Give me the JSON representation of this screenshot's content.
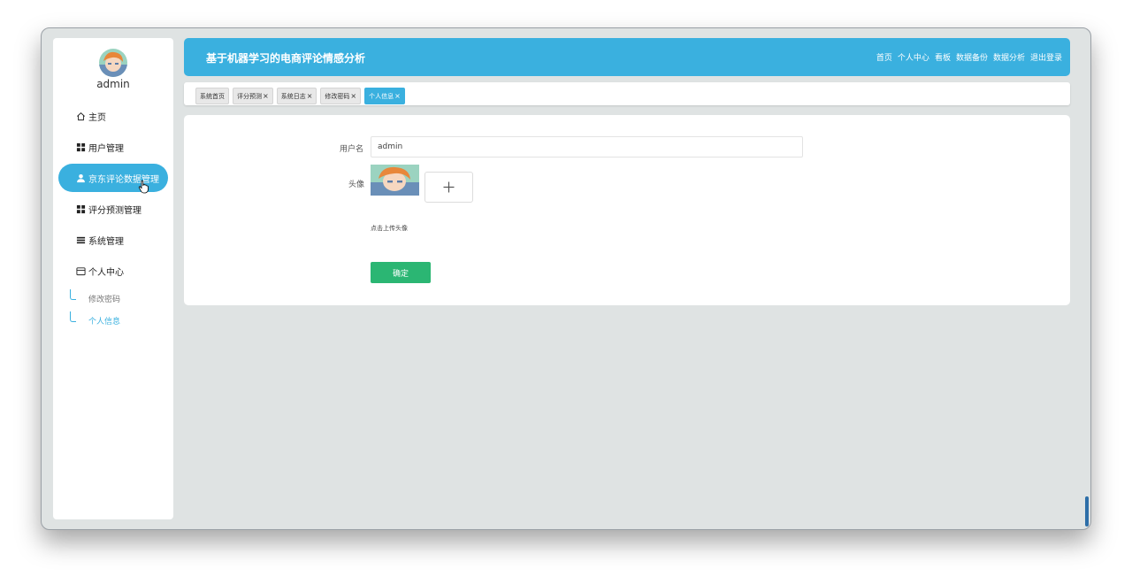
{
  "sidebar": {
    "user_name": "admin",
    "menu": [
      {
        "label": "主页",
        "icon": "home-icon"
      },
      {
        "label": "用户管理",
        "icon": "grid-icon"
      },
      {
        "label": "京东评论数据管理",
        "icon": "user-icon",
        "active": true
      },
      {
        "label": "评分预测管理",
        "icon": "grid-icon"
      },
      {
        "label": "系统管理",
        "icon": "list-icon"
      },
      {
        "label": "个人中心",
        "icon": "folder-icon"
      }
    ],
    "submenu": [
      {
        "label": "修改密码"
      },
      {
        "label": "个人信息",
        "active": true
      }
    ]
  },
  "header": {
    "title": "基于机器学习的电商评论情感分析",
    "nav": [
      "首页",
      "个人中心",
      "看板",
      "数据备份",
      "数据分析",
      "退出登录"
    ]
  },
  "tabs": [
    {
      "label": "系统首页",
      "closable": false
    },
    {
      "label": "评分预测",
      "closable": true
    },
    {
      "label": "系统日志",
      "closable": true
    },
    {
      "label": "修改密码",
      "closable": true
    },
    {
      "label": "个人信息",
      "closable": true,
      "active": true
    }
  ],
  "tab_close_symbol": "×",
  "form": {
    "username_label": "用户名",
    "username_value": "admin",
    "avatar_label": "头像",
    "upload_hint": "点击上传头像",
    "confirm_label": "确定"
  },
  "colors": {
    "accent": "#3ab0df",
    "confirm": "#2bb673",
    "background": "#dfe3e3"
  }
}
